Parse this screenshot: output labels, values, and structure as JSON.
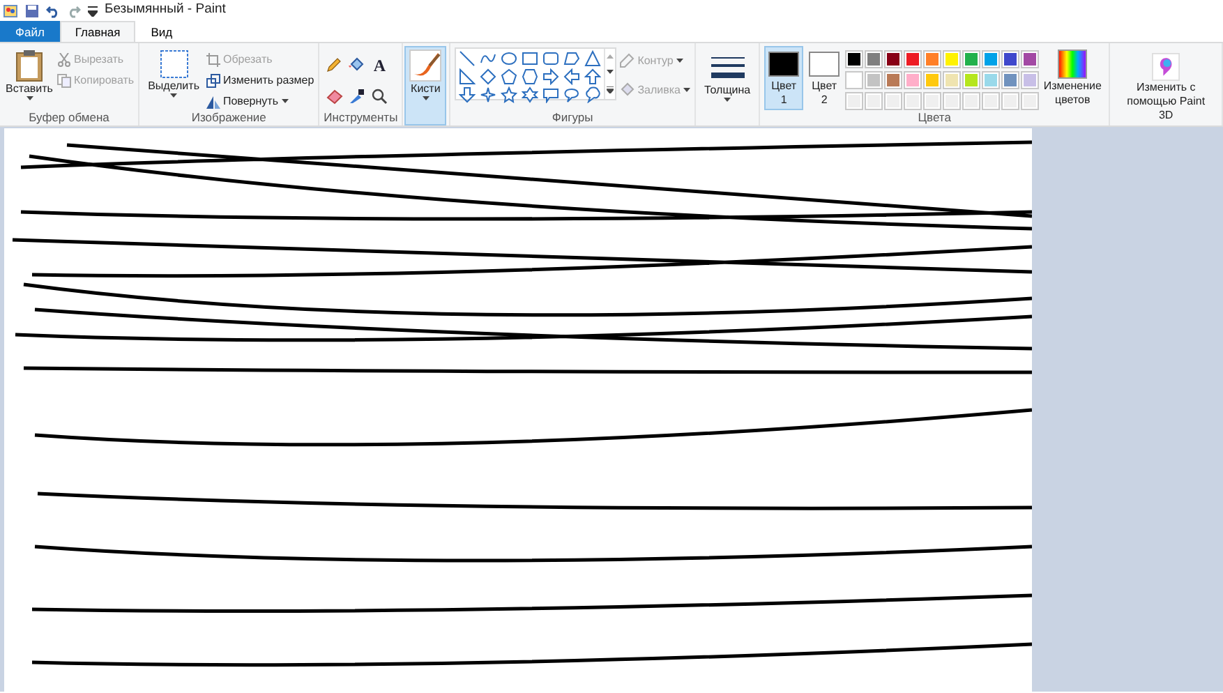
{
  "window": {
    "title": "Безымянный - Paint"
  },
  "tabs": [
    {
      "label": "Файл",
      "kind": "file",
      "selected": false
    },
    {
      "label": "Главная",
      "kind": "tab",
      "selected": true
    },
    {
      "label": "Вид",
      "kind": "tab",
      "selected": false
    }
  ],
  "clipboard": {
    "paste": "Вставить",
    "cut": {
      "label": "Вырезать",
      "disabled": true
    },
    "copy": {
      "label": "Копировать",
      "disabled": true
    },
    "group_label": "Буфер обмена"
  },
  "image": {
    "select": "Выделить",
    "crop": {
      "label": "Обрезать",
      "disabled": true
    },
    "resize": {
      "label": "Изменить размер",
      "disabled": false
    },
    "rotate": {
      "label": "Повернуть",
      "disabled": false
    },
    "group_label": "Изображение"
  },
  "tools": {
    "text_glyph": "A",
    "group_label": "Инструменты"
  },
  "brushes": {
    "label": "Кисти",
    "selected": true
  },
  "shapes": {
    "outline": {
      "label": "Контур",
      "disabled": true
    },
    "fill": {
      "label": "Заливка",
      "disabled": true
    },
    "group_label": "Фигуры"
  },
  "size": {
    "label": "Толщина"
  },
  "colors": {
    "color1": {
      "label": "Цвет 1",
      "color": "#000000",
      "selected": true
    },
    "color2": {
      "label": "Цвет 2",
      "color": "#ffffff",
      "selected": false
    },
    "palette": [
      {
        "kind": "swatch",
        "color": "#000000"
      },
      {
        "kind": "swatch",
        "color": "#7f7f7f"
      },
      {
        "kind": "swatch",
        "color": "#880015"
      },
      {
        "kind": "swatch",
        "color": "#ed1c24"
      },
      {
        "kind": "swatch",
        "color": "#ff7f27"
      },
      {
        "kind": "swatch",
        "color": "#fff200"
      },
      {
        "kind": "swatch",
        "color": "#22b14c"
      },
      {
        "kind": "swatch",
        "color": "#00a2e8"
      },
      {
        "kind": "swatch",
        "color": "#3f48cc"
      },
      {
        "kind": "swatch",
        "color": "#a349a4"
      },
      {
        "kind": "swatch",
        "color": "#ffffff"
      },
      {
        "kind": "swatch",
        "color": "#c3c3c3"
      },
      {
        "kind": "swatch",
        "color": "#b97a57"
      },
      {
        "kind": "swatch",
        "color": "#ffaec9"
      },
      {
        "kind": "swatch",
        "color": "#ffc90e"
      },
      {
        "kind": "swatch",
        "color": "#efe4b0"
      },
      {
        "kind": "swatch",
        "color": "#b5e61d"
      },
      {
        "kind": "swatch",
        "color": "#99d9ea"
      },
      {
        "kind": "swatch",
        "color": "#7092be"
      },
      {
        "kind": "swatch",
        "color": "#c8bfe7"
      },
      {
        "kind": "empty"
      },
      {
        "kind": "empty"
      },
      {
        "kind": "empty"
      },
      {
        "kind": "empty"
      },
      {
        "kind": "empty"
      },
      {
        "kind": "empty"
      },
      {
        "kind": "empty"
      },
      {
        "kind": "empty"
      },
      {
        "kind": "empty"
      },
      {
        "kind": "empty"
      }
    ],
    "edit_colors": "Изменение цветов",
    "group_label": "Цвета"
  },
  "paint3d": {
    "label": "Изменить с помощью Paint 3D"
  }
}
